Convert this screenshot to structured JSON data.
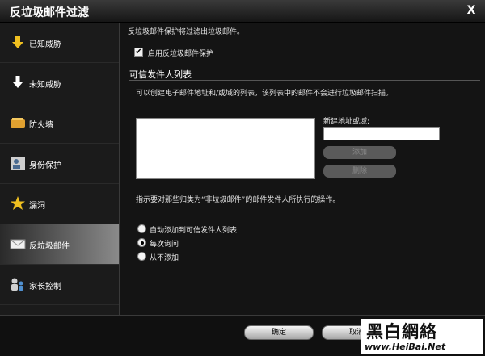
{
  "window": {
    "title": "反垃圾邮件过滤",
    "close_glyph": "X"
  },
  "sidebar": {
    "items": [
      {
        "label": "已知威胁",
        "icon": "arrow-down-yellow-icon"
      },
      {
        "label": "未知威胁",
        "icon": "arrow-down-white-icon"
      },
      {
        "label": "防火墙",
        "icon": "firewall-icon"
      },
      {
        "label": "身份保护",
        "icon": "identity-icon"
      },
      {
        "label": "漏洞",
        "icon": "star-icon"
      },
      {
        "label": "反垃圾邮件",
        "icon": "mail-icon",
        "active": true
      },
      {
        "label": "家长控制",
        "icon": "parental-icon"
      }
    ]
  },
  "main": {
    "description": "反垃圾邮件保护将过滤出垃圾邮件。",
    "enable_checkbox": {
      "label": "启用反垃圾邮件保护",
      "checked": true
    },
    "trusted_section": {
      "title": "可信发件人列表",
      "description": "可以创建电子邮件地址和/或域的列表，该列表中的邮件不会进行垃圾邮件扫描。",
      "new_address_label": "新建地址或域:",
      "new_address_value": "",
      "add_button": "添加",
      "delete_button": "删除"
    },
    "hint": "指示要对那些归类为“非垃圾邮件”的邮件发件人所执行的操作。",
    "radios": [
      {
        "label": "自动添加到可信发件人列表",
        "selected": false
      },
      {
        "label": "每次询问",
        "selected": true
      },
      {
        "label": "从不添加",
        "selected": false
      }
    ]
  },
  "footer": {
    "ok_button": "确定",
    "cancel_button": "取消"
  },
  "watermark": {
    "logo": "黑白網絡",
    "url": "www.HeiBai.Net"
  },
  "colors": {
    "accent_yellow": "#f0c020",
    "active_gradient_end": "#8a8a8a"
  }
}
